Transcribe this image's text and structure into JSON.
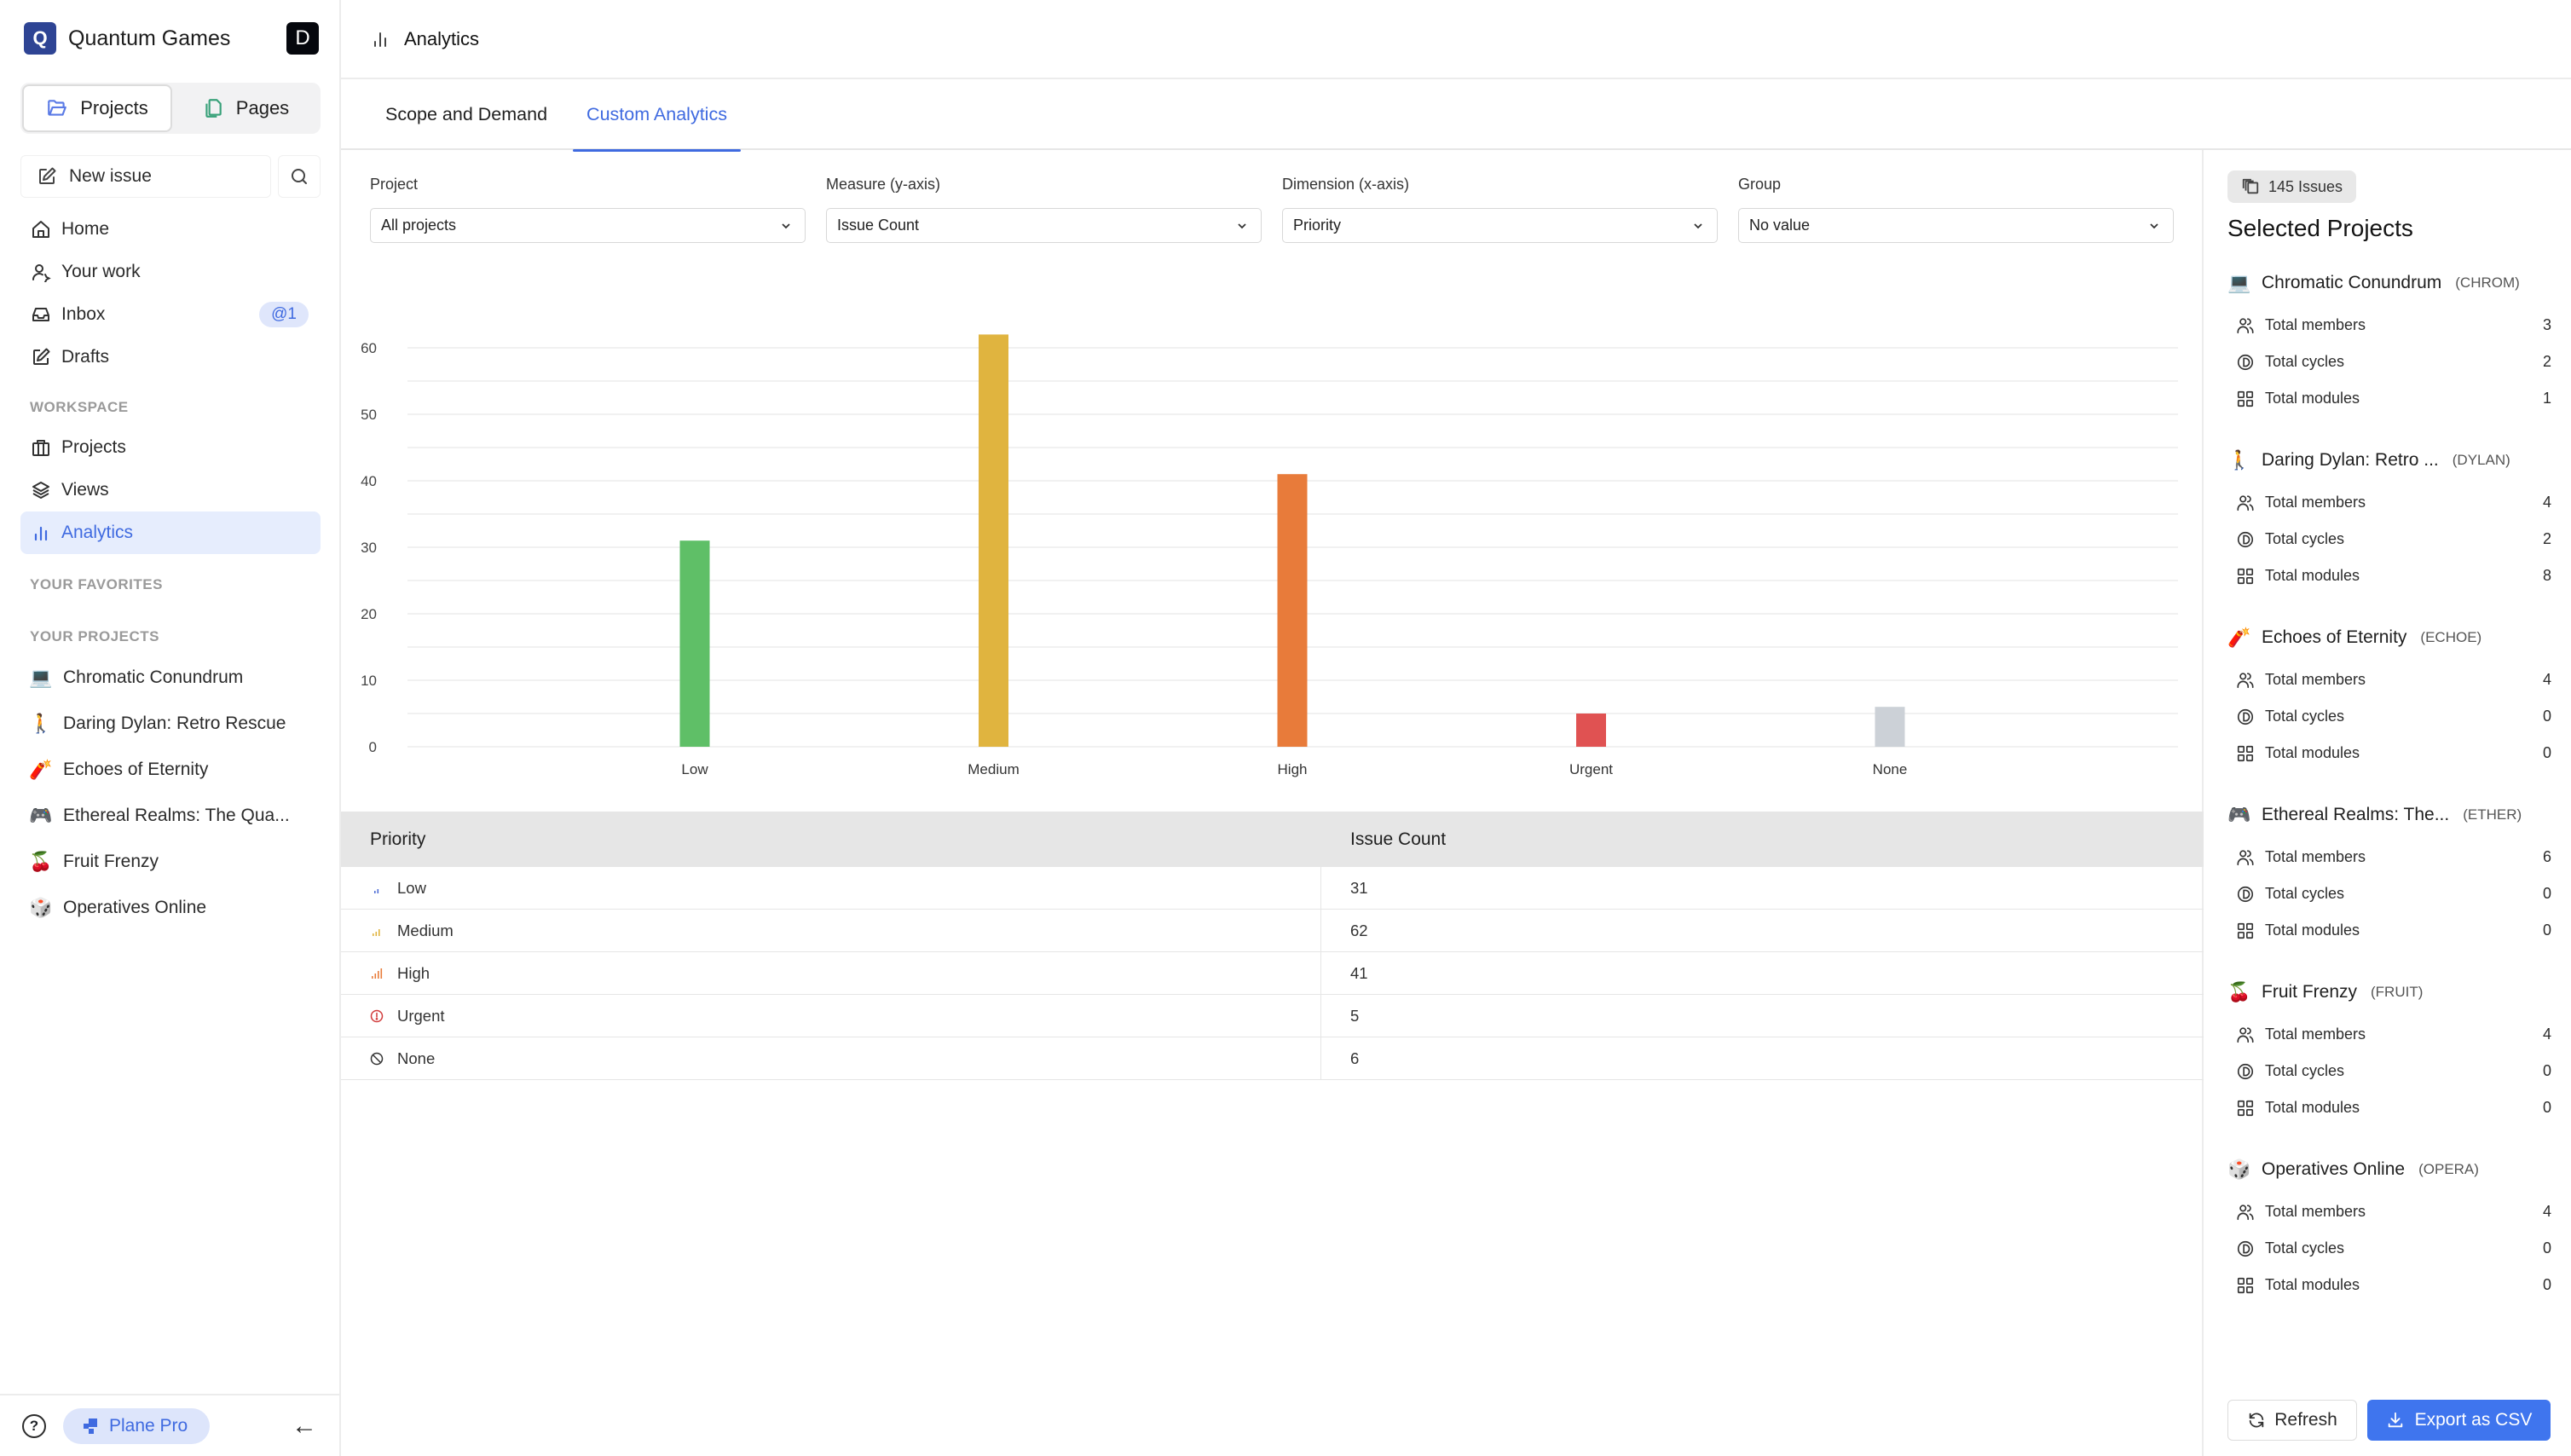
{
  "workspace": {
    "logo_letter": "Q",
    "name": "Quantum Games",
    "avatar_letter": "D"
  },
  "sidebar": {
    "switcher": [
      {
        "label": "Projects",
        "icon": "folder-open-icon",
        "active": true
      },
      {
        "label": "Pages",
        "icon": "pages-icon",
        "active": false
      }
    ],
    "new_issue_label": "New issue",
    "nav": [
      {
        "label": "Home",
        "icon": "home-icon"
      },
      {
        "label": "Your work",
        "icon": "user-activity-icon"
      },
      {
        "label": "Inbox",
        "icon": "inbox-icon",
        "badge": "@1"
      },
      {
        "label": "Drafts",
        "icon": "pencil-square-icon"
      }
    ],
    "workspace_label": "WORKSPACE",
    "workspace_nav": [
      {
        "label": "Projects",
        "icon": "briefcase-icon"
      },
      {
        "label": "Views",
        "icon": "layers-icon"
      },
      {
        "label": "Analytics",
        "icon": "bar-chart-icon",
        "active": true
      }
    ],
    "favorites_label": "YOUR FAVORITES",
    "projects_label": "YOUR PROJECTS",
    "projects": [
      {
        "emoji": "💻",
        "name": "Chromatic Conundrum"
      },
      {
        "emoji": "🚶",
        "name": "Daring Dylan: Retro Rescue"
      },
      {
        "emoji": "🧨",
        "name": "Echoes of Eternity"
      },
      {
        "emoji": "🎮",
        "name": "Ethereal Realms: The Qua..."
      },
      {
        "emoji": "🍒",
        "name": "Fruit Frenzy"
      },
      {
        "emoji": "🎲",
        "name": "Operatives Online"
      }
    ],
    "footer": {
      "plan_label": "Plane Pro",
      "help": "?",
      "collapse": "←"
    }
  },
  "header": {
    "title": "Analytics"
  },
  "tabs": [
    {
      "label": "Scope and Demand",
      "active": false
    },
    {
      "label": "Custom Analytics",
      "active": true
    }
  ],
  "filters": [
    {
      "label": "Project",
      "value": "All projects"
    },
    {
      "label": "Measure (y-axis)",
      "value": "Issue Count"
    },
    {
      "label": "Dimension (x-axis)",
      "value": "Priority"
    },
    {
      "label": "Group",
      "value": "No value"
    }
  ],
  "chart_data": {
    "type": "bar",
    "title": "",
    "xlabel": "",
    "ylabel": "",
    "categories": [
      "Low",
      "Medium",
      "High",
      "Urgent",
      "None"
    ],
    "values": [
      31,
      62,
      41,
      5,
      6
    ],
    "colors": [
      "#5fbf67",
      "#e0b43f",
      "#e87b3a",
      "#e05252",
      "#ccd1d7"
    ],
    "yticks": [
      0,
      10,
      20,
      30,
      40,
      50,
      60
    ],
    "ylim": [
      0,
      60
    ],
    "grid": true,
    "grid_step": 5,
    "legend": "none"
  },
  "table": {
    "columns": [
      "Priority",
      "Issue Count"
    ],
    "rows": [
      {
        "priority": "Low",
        "icon": "priority-low-icon",
        "count": "31"
      },
      {
        "priority": "Medium",
        "icon": "priority-medium-icon",
        "count": "62"
      },
      {
        "priority": "High",
        "icon": "priority-high-icon",
        "count": "41"
      },
      {
        "priority": "Urgent",
        "icon": "alert-circle-icon",
        "count": "5"
      },
      {
        "priority": "None",
        "icon": "ban-icon",
        "count": "6"
      }
    ]
  },
  "right_panel": {
    "issues_chip": "145 Issues",
    "title": "Selected Projects",
    "stat_labels": {
      "members": "Total members",
      "cycles": "Total cycles",
      "modules": "Total modules"
    },
    "projects": [
      {
        "emoji": "💻",
        "name": "Chromatic Conundrum",
        "identifier": "(CHROM)",
        "members": "3",
        "cycles": "2",
        "modules": "1"
      },
      {
        "emoji": "🚶",
        "name": "Daring Dylan: Retro ...",
        "identifier": "(DYLAN)",
        "members": "4",
        "cycles": "2",
        "modules": "8"
      },
      {
        "emoji": "🧨",
        "name": "Echoes of Eternity",
        "identifier": "(ECHOE)",
        "members": "4",
        "cycles": "0",
        "modules": "0"
      },
      {
        "emoji": "🎮",
        "name": "Ethereal Realms: The...",
        "identifier": "(ETHER)",
        "members": "6",
        "cycles": "0",
        "modules": "0"
      },
      {
        "emoji": "🍒",
        "name": "Fruit Frenzy",
        "identifier": "(FRUIT)",
        "members": "4",
        "cycles": "0",
        "modules": "0"
      },
      {
        "emoji": "🎲",
        "name": "Operatives Online",
        "identifier": "(OPERA)",
        "members": "4",
        "cycles": "0",
        "modules": "0"
      }
    ],
    "refresh_label": "Refresh",
    "export_label": "Export as CSV"
  },
  "colors": {
    "accent": "#3f6ae0",
    "export_button": "#3f75ee",
    "active_nav_bg": "#e6edfd"
  }
}
